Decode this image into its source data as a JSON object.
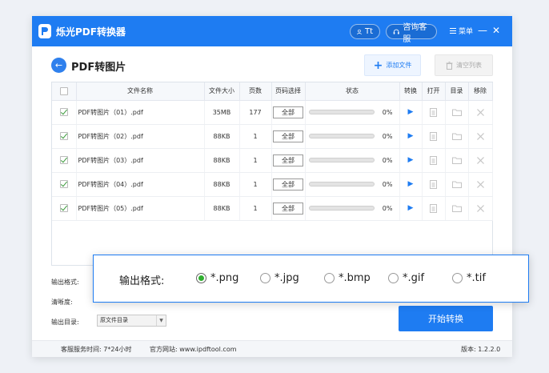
{
  "app": {
    "title": "烁光PDF转换器",
    "user_label": "Tt",
    "service_label": "咨询客服",
    "menu_label": "菜单",
    "minimize_glyph": "—",
    "close_glyph": "✕"
  },
  "page": {
    "title": "PDF转图片",
    "add_file_label": "添加文件",
    "clear_list_label": "清空列表"
  },
  "table": {
    "headers": [
      "",
      "文件名称",
      "文件大小",
      "页数",
      "页码选择",
      "状态",
      "转换",
      "打开",
      "目录",
      "移除"
    ],
    "rows": [
      {
        "checked": true,
        "name": "PDF转图片（01）.pdf",
        "size": "35MB",
        "pages": "177",
        "page_select": "全部",
        "progress": 0,
        "progress_text": "0%"
      },
      {
        "checked": true,
        "name": "PDF转图片（02）.pdf",
        "size": "88KB",
        "pages": "1",
        "page_select": "全部",
        "progress": 0,
        "progress_text": "0%"
      },
      {
        "checked": true,
        "name": "PDF转图片（03）.pdf",
        "size": "88KB",
        "pages": "1",
        "page_select": "全部",
        "progress": 0,
        "progress_text": "0%"
      },
      {
        "checked": true,
        "name": "PDF转图片（04）.pdf",
        "size": "88KB",
        "pages": "1",
        "page_select": "全部",
        "progress": 0,
        "progress_text": "0%"
      },
      {
        "checked": true,
        "name": "PDF转图片（05）.pdf",
        "size": "88KB",
        "pages": "1",
        "page_select": "全部",
        "progress": 0,
        "progress_text": "0%"
      }
    ]
  },
  "settings": {
    "format_label": "输出格式:",
    "clarity_label": "清晰度:",
    "output_dir_label": "输出目录:",
    "output_dir_value": "原文件目录",
    "start_label": "开始转换"
  },
  "format_popup": {
    "label": "输出格式:",
    "options": [
      "*.png",
      "*.jpg",
      "*.bmp",
      "*.gif",
      "*.tif"
    ],
    "selected_index": 0
  },
  "footer": {
    "service_hours": "客服服务时间: 7*24小时",
    "website": "官方网站: www.ipdftool.com",
    "version": "版本: 1.2.2.0"
  },
  "colors": {
    "primary": "#1e7cf2",
    "radio_selected": "#2fae2f",
    "checkbox_check": "#3a9a3a"
  }
}
